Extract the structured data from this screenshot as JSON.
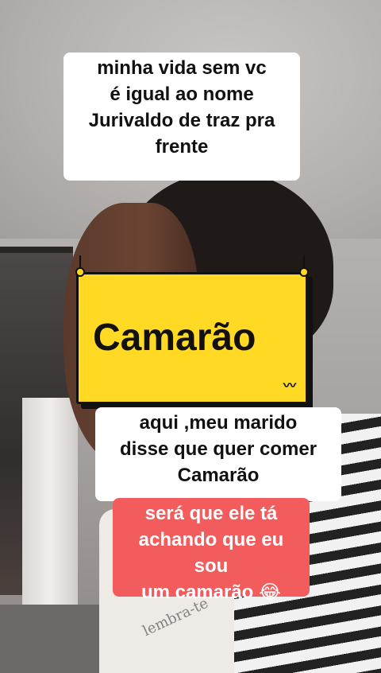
{
  "captions": {
    "top": [
      "minha vida sem vc",
      "é igual ao nome",
      "Jurivaldo de traz pra",
      "frente"
    ],
    "middle": [
      "aqui ,meu marido",
      "disse que quer comer",
      "Camarão"
    ],
    "bottom": [
      "será que ele tá",
      "achando que eu sou",
      "um camarão 😂"
    ]
  },
  "sign": {
    "word": "Camarão",
    "decoration": "〰"
  },
  "shirt_print": "lembra-te",
  "colors": {
    "sign_bg": "#ffd923",
    "bottom_caption_bg": "#f25c5c"
  }
}
